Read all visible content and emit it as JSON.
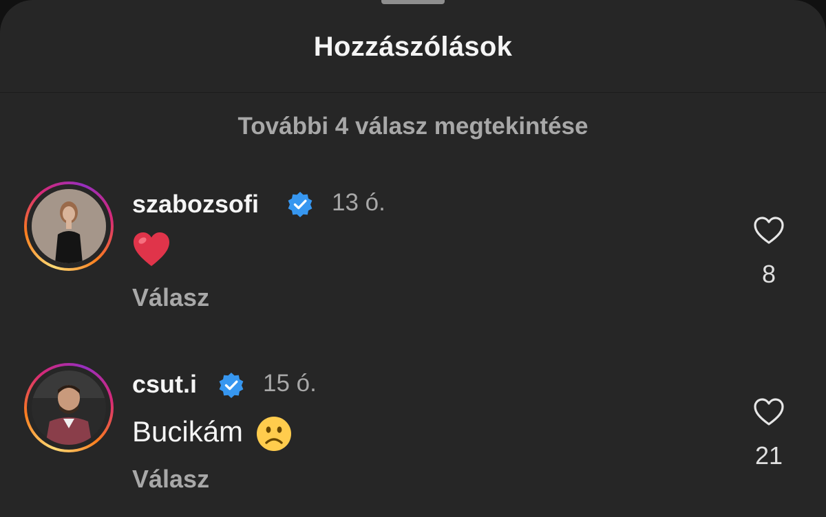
{
  "sheet": {
    "title": "Hozzászólások"
  },
  "thread": {
    "view_more_replies": "További 4 válasz megtekintése"
  },
  "comments": [
    {
      "username": "szabozsofi",
      "verified": true,
      "time": "13 ó.",
      "text": "",
      "emoji": "red-heart",
      "reply_label": "Válasz",
      "likes": "8"
    },
    {
      "username": "csut.i",
      "verified": true,
      "time": "15 ó.",
      "text": "Bucikám",
      "emoji": "slightly-frowning-face",
      "reply_label": "Válasz",
      "likes": "21"
    }
  ],
  "colors": {
    "background": "#262626",
    "text_primary": "#f5f5f5",
    "text_secondary": "#a8a8a8",
    "verified_blue": "#3797f0",
    "heart_red": "#e0344a",
    "emoji_yellow": "#ffcc4d"
  }
}
